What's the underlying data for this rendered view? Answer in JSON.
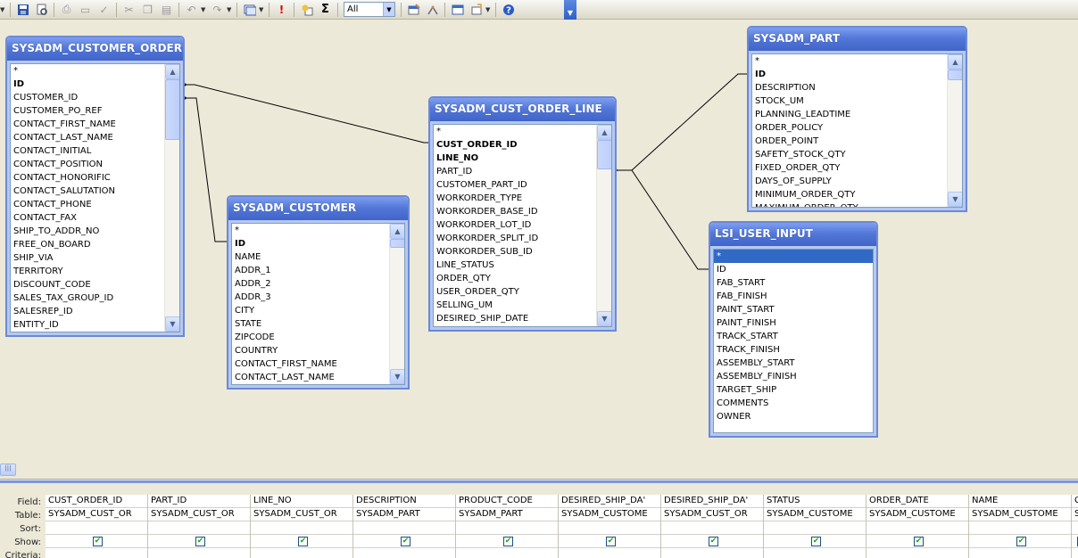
{
  "toolbar": {
    "view_select": "All",
    "sigma": "Σ"
  },
  "tables": {
    "customer_order": {
      "title": "SYSADM_CUSTOMER_ORDER",
      "fields": [
        "*",
        "ID",
        "CUSTOMER_ID",
        "CUSTOMER_PO_REF",
        "CONTACT_FIRST_NAME",
        "CONTACT_LAST_NAME",
        "CONTACT_INITIAL",
        "CONTACT_POSITION",
        "CONTACT_HONORIFIC",
        "CONTACT_SALUTATION",
        "CONTACT_PHONE",
        "CONTACT_FAX",
        "SHIP_TO_ADDR_NO",
        "FREE_ON_BOARD",
        "SHIP_VIA",
        "TERRITORY",
        "DISCOUNT_CODE",
        "SALES_TAX_GROUP_ID",
        "SALESREP_ID",
        "ENTITY_ID"
      ]
    },
    "customer": {
      "title": "SYSADM_CUSTOMER",
      "fields": [
        "*",
        "ID",
        "NAME",
        "ADDR_1",
        "ADDR_2",
        "ADDR_3",
        "CITY",
        "STATE",
        "ZIPCODE",
        "COUNTRY",
        "CONTACT_FIRST_NAME",
        "CONTACT_LAST_NAME"
      ]
    },
    "cust_order_line": {
      "title": "SYSADM_CUST_ORDER_LINE",
      "fields": [
        "*",
        "CUST_ORDER_ID",
        "LINE_NO",
        "PART_ID",
        "CUSTOMER_PART_ID",
        "WORKORDER_TYPE",
        "WORKORDER_BASE_ID",
        "WORKORDER_LOT_ID",
        "WORKORDER_SPLIT_ID",
        "WORKORDER_SUB_ID",
        "LINE_STATUS",
        "ORDER_QTY",
        "USER_ORDER_QTY",
        "SELLING_UM",
        "DESIRED_SHIP_DATE"
      ]
    },
    "part": {
      "title": "SYSADM_PART",
      "fields": [
        "*",
        "ID",
        "DESCRIPTION",
        "STOCK_UM",
        "PLANNING_LEADTIME",
        "ORDER_POLICY",
        "ORDER_POINT",
        "SAFETY_STOCK_QTY",
        "FIXED_ORDER_QTY",
        "DAYS_OF_SUPPLY",
        "MINIMUM_ORDER_QTY",
        "MAXIMUM_ORDER_QTY"
      ]
    },
    "lsi_user_input": {
      "title": "LSI_USER_INPUT",
      "fields": [
        "*",
        "ID",
        "FAB_START",
        "FAB_FINISH",
        "PAINT_START",
        "PAINT_FINISH",
        "TRACK_START",
        "TRACK_FINISH",
        "ASSEMBLY_START",
        "ASSEMBLY_FINISH",
        "TARGET_SHIP",
        "COMMENTS",
        "OWNER"
      ]
    }
  },
  "grid": {
    "row_labels": [
      "Field:",
      "Table:",
      "Sort:",
      "Show:",
      "Criteria:"
    ],
    "columns": [
      {
        "field": "CUST_ORDER_ID",
        "table": "SYSADM_CUST_OR",
        "show": true
      },
      {
        "field": "PART_ID",
        "table": "SYSADM_CUST_OR",
        "show": true
      },
      {
        "field": "LINE_NO",
        "table": "SYSADM_CUST_OR",
        "show": true
      },
      {
        "field": "DESCRIPTION",
        "table": "SYSADM_PART",
        "show": true
      },
      {
        "field": "PRODUCT_CODE",
        "table": "SYSADM_PART",
        "show": true
      },
      {
        "field": "DESIRED_SHIP_DA'",
        "table": "SYSADM_CUSTOME",
        "show": true
      },
      {
        "field": "DESIRED_SHIP_DA'",
        "table": "SYSADM_CUST_OR",
        "show": true
      },
      {
        "field": "STATUS",
        "table": "SYSADM_CUSTOME",
        "show": true
      },
      {
        "field": "ORDER_DATE",
        "table": "SYSADM_CUSTOME",
        "show": true
      },
      {
        "field": "NAME",
        "table": "SYSADM_CUSTOME",
        "show": true
      },
      {
        "field": "C",
        "table": "S",
        "show": true
      }
    ]
  }
}
